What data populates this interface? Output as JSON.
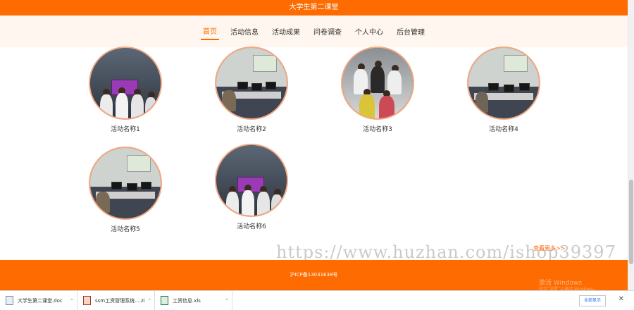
{
  "header": {
    "title": "大学生第二课堂"
  },
  "nav": {
    "items": [
      {
        "label": "首页",
        "active": true
      },
      {
        "label": "活动信息",
        "active": false
      },
      {
        "label": "活动成果",
        "active": false
      },
      {
        "label": "问卷调查",
        "active": false
      },
      {
        "label": "个人中心",
        "active": false
      },
      {
        "label": "后台管理",
        "active": false
      }
    ]
  },
  "activities": [
    {
      "label": "活动名称1",
      "photo": "group-stage-photo"
    },
    {
      "label": "活动名称2",
      "photo": "computer-lab-photo"
    },
    {
      "label": "活动名称3",
      "photo": "team-group-photo"
    },
    {
      "label": "活动名称4",
      "photo": "computer-lab-photo"
    },
    {
      "label": "活动名称5",
      "photo": "computer-lab-photo"
    },
    {
      "label": "活动名称6",
      "photo": "group-stage-photo"
    }
  ],
  "more_link": "查看更多>>",
  "watermark": "https://www.huzhan.com/ishop39397",
  "footer": {
    "icp": "沪ICP备13031638号"
  },
  "windows_activation": {
    "line1": "激活 Windows",
    "line2": "转到“设置”以激活 Windows。"
  },
  "downloads": {
    "items": [
      {
        "name": "大学生第二课堂.doc",
        "type": "doc"
      },
      {
        "name": "ssm工资管理系统....zip",
        "type": "zip"
      },
      {
        "name": "工资信息.xls",
        "type": "xls"
      }
    ],
    "show_all": "全部显示",
    "close": "✕"
  },
  "colors": {
    "accent": "#fe6b00",
    "nav_bg": "#fff7ef",
    "photo_border": "#f4a882"
  }
}
